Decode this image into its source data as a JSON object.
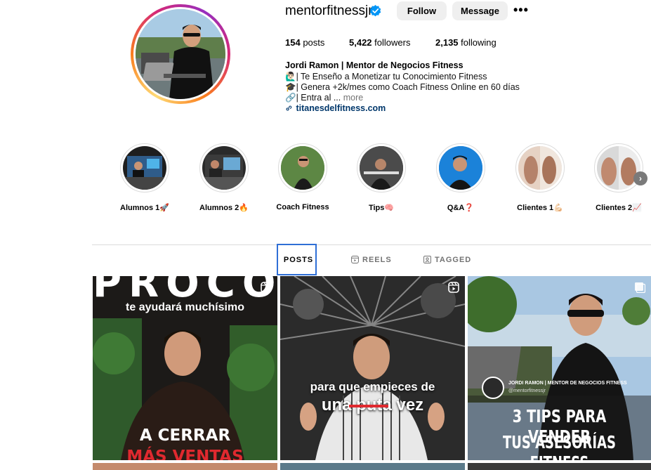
{
  "profile": {
    "username": "mentorfitnessjr",
    "follow_label": "Follow",
    "message_label": "Message",
    "more_label": "•••",
    "stats": {
      "posts_count": "154",
      "posts_label": "posts",
      "followers_count": "5,422",
      "followers_label": "followers",
      "following_count": "2,135",
      "following_label": "following"
    },
    "bio": {
      "name": "Jordi Ramon | Mentor de Negocios Fitness",
      "line1": "🙋🏻‍♂️| Te Enseño a Monetizar tu Conocimiento Fitness",
      "line2": "🎓| Genera +2k/mes como Coach Fitness Online en 60 días",
      "line3": "🔗| Entra al ...",
      "more": "more",
      "link_icon": "link-icon",
      "link": "titanesdelfitness.com"
    }
  },
  "highlights": [
    {
      "label": "Alumnos 1🚀"
    },
    {
      "label": "Alumnos 2🔥"
    },
    {
      "label": "Coach Fitness"
    },
    {
      "label": "Tips🧠"
    },
    {
      "label": "Q&A❓"
    },
    {
      "label": "Clientes 1💪🏻"
    },
    {
      "label": "Clientes 2📈"
    }
  ],
  "tabs": {
    "posts": "POSTS",
    "reels": "REELS",
    "tagged": "TAGGED"
  },
  "posts": [
    {
      "top_text": "PROCO",
      "subtitle": "te ayudará muchísimo",
      "caption1": "A CERRAR",
      "caption2": "MÁS VENTAS",
      "icon": "reel-icon"
    },
    {
      "caption1": "para que empieces de",
      "caption2": "una puta vez",
      "icon": "reel-icon"
    },
    {
      "brand_name": "JORDI RAMON | MENTOR DE NEGOCIOS FITNESS",
      "brand_handle": "@mentorfitnessjr",
      "caption1": "3 TIPS PARA VENDER",
      "caption2": "TUS ASESORÍAS FITNESS",
      "icon": "carousel-icon"
    }
  ],
  "colors": {
    "verified": "#0095f6",
    "button_bg": "#efefef",
    "link": "#00376b",
    "muted": "#737373",
    "accent_red": "#e0292f"
  }
}
